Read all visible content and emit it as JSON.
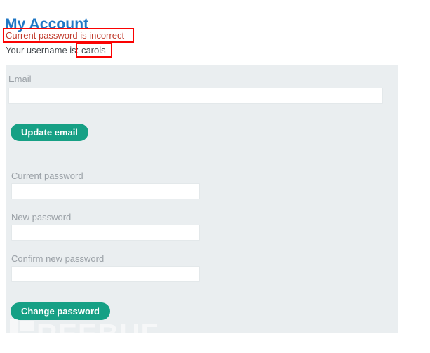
{
  "page": {
    "title": "My Account"
  },
  "messages": {
    "error": "Current password is incorrect",
    "username_prefix": "Your username is:",
    "username_value": "carols"
  },
  "annotations": {
    "error_highlight_color": "#fb0202",
    "username_highlight_color": "#fb0202"
  },
  "email_form": {
    "label": "Email",
    "value": "",
    "placeholder": "",
    "submit_label": "Update email"
  },
  "password_form": {
    "current_password": {
      "label": "Current password",
      "value": "",
      "placeholder": ""
    },
    "new_password": {
      "label": "New password",
      "value": "",
      "placeholder": ""
    },
    "confirm_password": {
      "label": "Confirm new password",
      "value": "",
      "placeholder": ""
    },
    "submit_label": "Change password"
  },
  "watermark": {
    "text": "REEBUF"
  },
  "colors": {
    "title": "#2077c4",
    "error_text": "#c0392b",
    "button": "#16a085",
    "panel_bg": "#eaeef0",
    "label": "#9aa0a6"
  }
}
